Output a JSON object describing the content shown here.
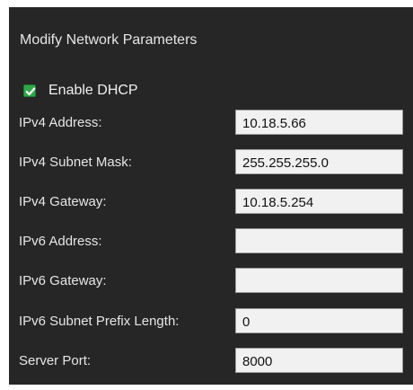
{
  "panel": {
    "title": "Modify Network Parameters"
  },
  "dhcp": {
    "label": "Enable DHCP",
    "checked": true,
    "check_color": "#2ea84a"
  },
  "fields": [
    {
      "label": "IPv4 Address:",
      "value": "10.18.5.66"
    },
    {
      "label": "IPv4 Subnet Mask:",
      "value": "255.255.255.0"
    },
    {
      "label": "IPv4 Gateway:",
      "value": "10.18.5.254"
    },
    {
      "label": "IPv6 Address:",
      "value": ""
    },
    {
      "label": "IPv6 Gateway:",
      "value": ""
    },
    {
      "label": "IPv6 Subnet Prefix Length:",
      "value": "0"
    },
    {
      "label": "Server Port:",
      "value": "8000"
    }
  ],
  "colors": {
    "panel_background": "#262626",
    "text": "#e6e6e6",
    "input_background": "#f1f1f1"
  }
}
